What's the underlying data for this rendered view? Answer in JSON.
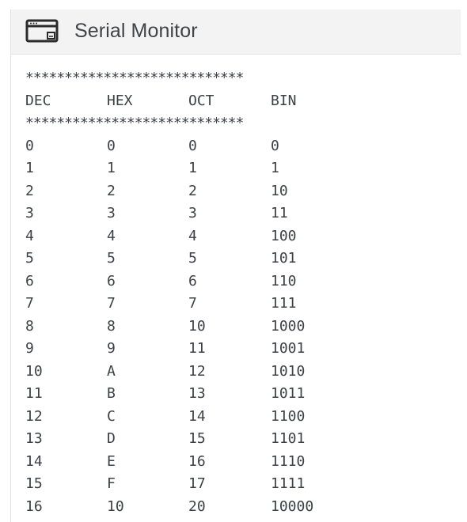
{
  "header": {
    "title": "Serial Monitor",
    "icon": "serial-monitor-window-icon"
  },
  "output": {
    "separator": "****************************",
    "columns": [
      "DEC",
      "HEX",
      "OCT",
      "BIN"
    ],
    "rows": [
      [
        "0",
        "0",
        "0",
        "0"
      ],
      [
        "1",
        "1",
        "1",
        "1"
      ],
      [
        "2",
        "2",
        "2",
        "10"
      ],
      [
        "3",
        "3",
        "3",
        "11"
      ],
      [
        "4",
        "4",
        "4",
        "100"
      ],
      [
        "5",
        "5",
        "5",
        "101"
      ],
      [
        "6",
        "6",
        "6",
        "110"
      ],
      [
        "7",
        "7",
        "7",
        "111"
      ],
      [
        "8",
        "8",
        "10",
        "1000"
      ],
      [
        "9",
        "9",
        "11",
        "1001"
      ],
      [
        "10",
        "A",
        "12",
        "1010"
      ],
      [
        "11",
        "B",
        "13",
        "1011"
      ],
      [
        "12",
        "C",
        "14",
        "1100"
      ],
      [
        "13",
        "D",
        "15",
        "1101"
      ],
      [
        "14",
        "E",
        "16",
        "1110"
      ],
      [
        "15",
        "F",
        "17",
        "1111"
      ],
      [
        "16",
        "10",
        "20",
        "10000"
      ]
    ]
  },
  "colors": {
    "header_bg": "#f3f3f3",
    "text": "#3d4045",
    "title": "#3f4448"
  }
}
